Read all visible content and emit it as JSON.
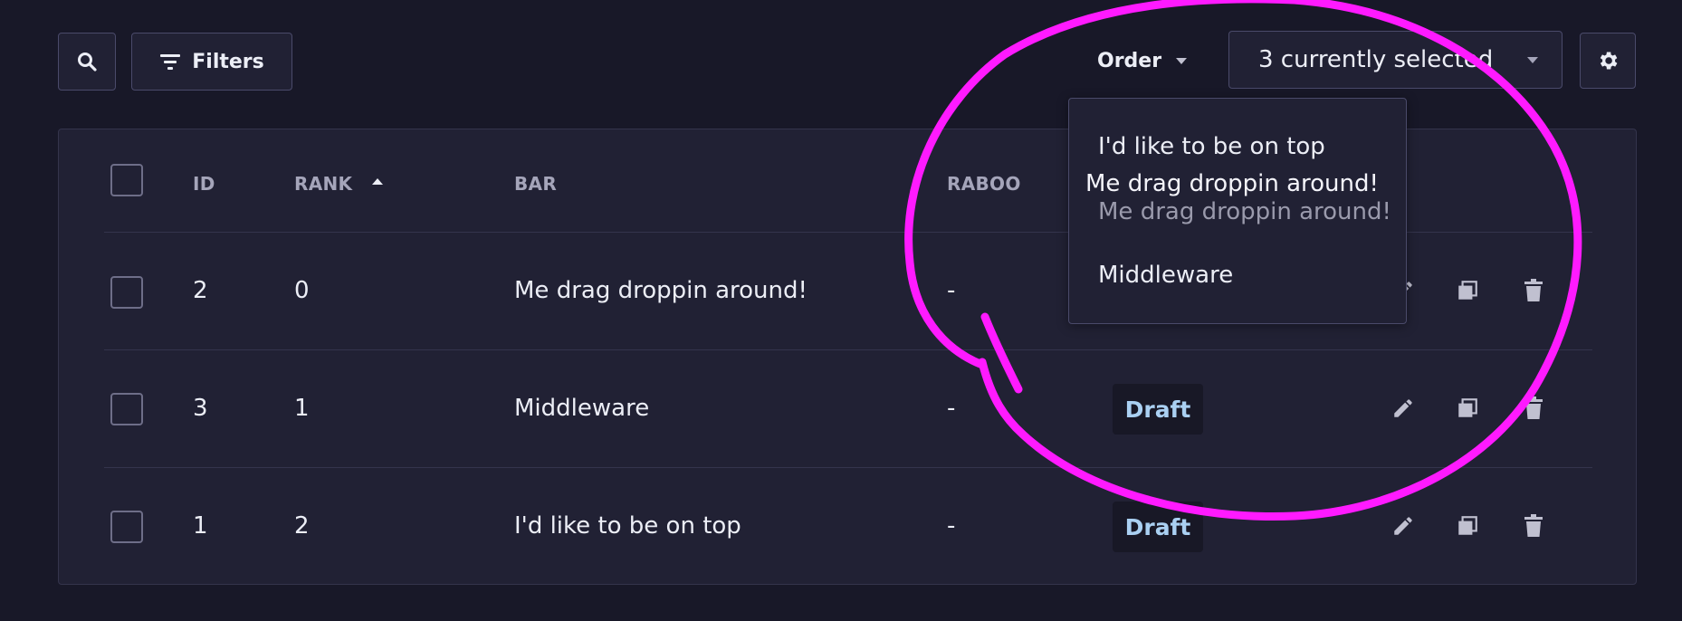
{
  "toolbar": {
    "filters_label": "Filters",
    "order_label": "Order",
    "selected_label": "3 currently selected"
  },
  "table": {
    "columns": [
      "ID",
      "RANK",
      "BAR",
      "RABOO"
    ],
    "rows": [
      {
        "id": "2",
        "rank": "0",
        "bar": "Me drag droppin around!",
        "raboo": "-",
        "status": ""
      },
      {
        "id": "3",
        "rank": "1",
        "bar": "Middleware",
        "raboo": "-",
        "status": "Draft"
      },
      {
        "id": "1",
        "rank": "2",
        "bar": "I'd like to be on top",
        "raboo": "-",
        "status": "Draft"
      }
    ]
  },
  "order_dropdown": {
    "items": [
      "I'd like to be on top",
      "Me drag droppin around!",
      "Middleware"
    ],
    "dragging_item": "Me drag droppin around!"
  },
  "colors": {
    "background": "#181828",
    "surface": "#212134",
    "badge_text": "#aad0f2",
    "annotation": "#ff1aff"
  },
  "icons": {
    "search": "search-icon",
    "filter": "filter-icon",
    "settings": "gear-icon",
    "sort": "sort-ascending-icon",
    "edit": "pencil-icon",
    "duplicate": "duplicate-icon",
    "delete": "trash-icon",
    "caret": "caret-down-icon"
  }
}
